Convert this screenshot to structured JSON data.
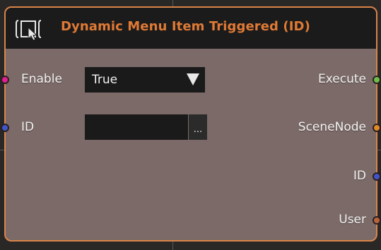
{
  "node": {
    "title": "Dynamic Menu Item Triggered (ID)",
    "icon": "menu-cursor-icon",
    "accent_color": "#d9844a",
    "title_color": "#e07a35",
    "body_color": "#7b6a67"
  },
  "inputs": [
    {
      "label": "Enable",
      "pin_color": "#e0208f"
    },
    {
      "label": "ID",
      "pin_color": "#4055c8"
    }
  ],
  "outputs": [
    {
      "label": "Execute",
      "pin_color": "#6cc04a"
    },
    {
      "label": "SceneNode",
      "pin_color": "#e08a2a"
    },
    {
      "label": "ID",
      "pin_color": "#4055c8"
    },
    {
      "label": "User",
      "pin_color": "#b8643a"
    }
  ],
  "enable_dropdown": {
    "selected": "True"
  },
  "id_field": {
    "value": "",
    "browse_label": "..."
  }
}
